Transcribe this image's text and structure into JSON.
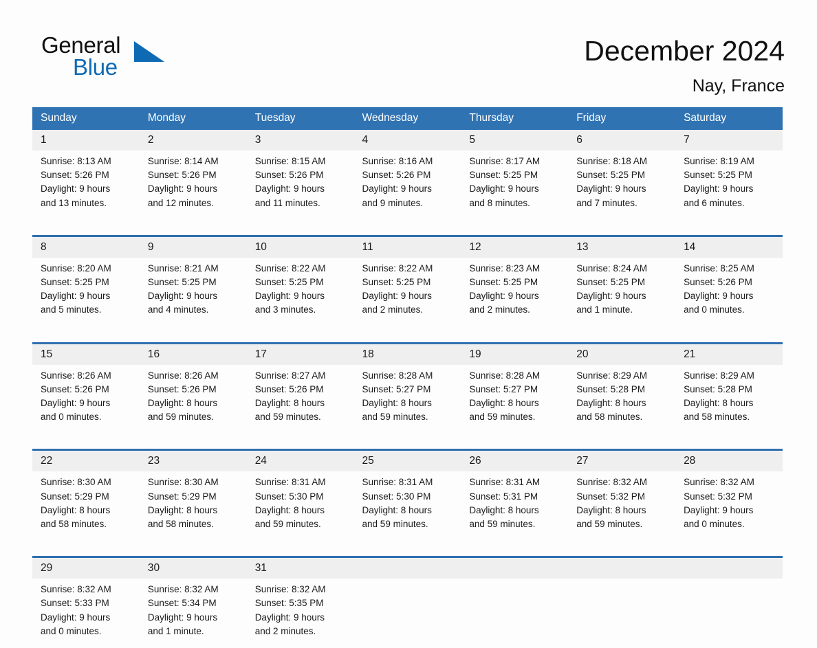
{
  "brand": {
    "name_part1": "General",
    "name_part2": "Blue",
    "logo_icon": "triangle-flag-icon",
    "accent_color": "#0f6ab4"
  },
  "header": {
    "title": "December 2024",
    "subtitle": "Nay, France"
  },
  "theme": {
    "header_blue": "#3073b3",
    "row_border_blue": "#2f6fb0",
    "daynum_band": "#efefef",
    "page_background": "#fdfdfd",
    "text": "#1a1a1a"
  },
  "calendar": {
    "weekday_headers": [
      "Sunday",
      "Monday",
      "Tuesday",
      "Wednesday",
      "Thursday",
      "Friday",
      "Saturday"
    ],
    "labels": {
      "sunrise_prefix": "Sunrise:",
      "sunset_prefix": "Sunset:",
      "daylight_prefix": "Daylight:"
    },
    "weeks": [
      [
        {
          "day": "1",
          "sunrise": "Sunrise: 8:13 AM",
          "sunset": "Sunset: 5:26 PM",
          "daylight_line1": "Daylight: 9 hours",
          "daylight_line2": "and 13 minutes."
        },
        {
          "day": "2",
          "sunrise": "Sunrise: 8:14 AM",
          "sunset": "Sunset: 5:26 PM",
          "daylight_line1": "Daylight: 9 hours",
          "daylight_line2": "and 12 minutes."
        },
        {
          "day": "3",
          "sunrise": "Sunrise: 8:15 AM",
          "sunset": "Sunset: 5:26 PM",
          "daylight_line1": "Daylight: 9 hours",
          "daylight_line2": "and 11 minutes."
        },
        {
          "day": "4",
          "sunrise": "Sunrise: 8:16 AM",
          "sunset": "Sunset: 5:26 PM",
          "daylight_line1": "Daylight: 9 hours",
          "daylight_line2": "and 9 minutes."
        },
        {
          "day": "5",
          "sunrise": "Sunrise: 8:17 AM",
          "sunset": "Sunset: 5:25 PM",
          "daylight_line1": "Daylight: 9 hours",
          "daylight_line2": "and 8 minutes."
        },
        {
          "day": "6",
          "sunrise": "Sunrise: 8:18 AM",
          "sunset": "Sunset: 5:25 PM",
          "daylight_line1": "Daylight: 9 hours",
          "daylight_line2": "and 7 minutes."
        },
        {
          "day": "7",
          "sunrise": "Sunrise: 8:19 AM",
          "sunset": "Sunset: 5:25 PM",
          "daylight_line1": "Daylight: 9 hours",
          "daylight_line2": "and 6 minutes."
        }
      ],
      [
        {
          "day": "8",
          "sunrise": "Sunrise: 8:20 AM",
          "sunset": "Sunset: 5:25 PM",
          "daylight_line1": "Daylight: 9 hours",
          "daylight_line2": "and 5 minutes."
        },
        {
          "day": "9",
          "sunrise": "Sunrise: 8:21 AM",
          "sunset": "Sunset: 5:25 PM",
          "daylight_line1": "Daylight: 9 hours",
          "daylight_line2": "and 4 minutes."
        },
        {
          "day": "10",
          "sunrise": "Sunrise: 8:22 AM",
          "sunset": "Sunset: 5:25 PM",
          "daylight_line1": "Daylight: 9 hours",
          "daylight_line2": "and 3 minutes."
        },
        {
          "day": "11",
          "sunrise": "Sunrise: 8:22 AM",
          "sunset": "Sunset: 5:25 PM",
          "daylight_line1": "Daylight: 9 hours",
          "daylight_line2": "and 2 minutes."
        },
        {
          "day": "12",
          "sunrise": "Sunrise: 8:23 AM",
          "sunset": "Sunset: 5:25 PM",
          "daylight_line1": "Daylight: 9 hours",
          "daylight_line2": "and 2 minutes."
        },
        {
          "day": "13",
          "sunrise": "Sunrise: 8:24 AM",
          "sunset": "Sunset: 5:25 PM",
          "daylight_line1": "Daylight: 9 hours",
          "daylight_line2": "and 1 minute."
        },
        {
          "day": "14",
          "sunrise": "Sunrise: 8:25 AM",
          "sunset": "Sunset: 5:26 PM",
          "daylight_line1": "Daylight: 9 hours",
          "daylight_line2": "and 0 minutes."
        }
      ],
      [
        {
          "day": "15",
          "sunrise": "Sunrise: 8:26 AM",
          "sunset": "Sunset: 5:26 PM",
          "daylight_line1": "Daylight: 9 hours",
          "daylight_line2": "and 0 minutes."
        },
        {
          "day": "16",
          "sunrise": "Sunrise: 8:26 AM",
          "sunset": "Sunset: 5:26 PM",
          "daylight_line1": "Daylight: 8 hours",
          "daylight_line2": "and 59 minutes."
        },
        {
          "day": "17",
          "sunrise": "Sunrise: 8:27 AM",
          "sunset": "Sunset: 5:26 PM",
          "daylight_line1": "Daylight: 8 hours",
          "daylight_line2": "and 59 minutes."
        },
        {
          "day": "18",
          "sunrise": "Sunrise: 8:28 AM",
          "sunset": "Sunset: 5:27 PM",
          "daylight_line1": "Daylight: 8 hours",
          "daylight_line2": "and 59 minutes."
        },
        {
          "day": "19",
          "sunrise": "Sunrise: 8:28 AM",
          "sunset": "Sunset: 5:27 PM",
          "daylight_line1": "Daylight: 8 hours",
          "daylight_line2": "and 59 minutes."
        },
        {
          "day": "20",
          "sunrise": "Sunrise: 8:29 AM",
          "sunset": "Sunset: 5:28 PM",
          "daylight_line1": "Daylight: 8 hours",
          "daylight_line2": "and 58 minutes."
        },
        {
          "day": "21",
          "sunrise": "Sunrise: 8:29 AM",
          "sunset": "Sunset: 5:28 PM",
          "daylight_line1": "Daylight: 8 hours",
          "daylight_line2": "and 58 minutes."
        }
      ],
      [
        {
          "day": "22",
          "sunrise": "Sunrise: 8:30 AM",
          "sunset": "Sunset: 5:29 PM",
          "daylight_line1": "Daylight: 8 hours",
          "daylight_line2": "and 58 minutes."
        },
        {
          "day": "23",
          "sunrise": "Sunrise: 8:30 AM",
          "sunset": "Sunset: 5:29 PM",
          "daylight_line1": "Daylight: 8 hours",
          "daylight_line2": "and 58 minutes."
        },
        {
          "day": "24",
          "sunrise": "Sunrise: 8:31 AM",
          "sunset": "Sunset: 5:30 PM",
          "daylight_line1": "Daylight: 8 hours",
          "daylight_line2": "and 59 minutes."
        },
        {
          "day": "25",
          "sunrise": "Sunrise: 8:31 AM",
          "sunset": "Sunset: 5:30 PM",
          "daylight_line1": "Daylight: 8 hours",
          "daylight_line2": "and 59 minutes."
        },
        {
          "day": "26",
          "sunrise": "Sunrise: 8:31 AM",
          "sunset": "Sunset: 5:31 PM",
          "daylight_line1": "Daylight: 8 hours",
          "daylight_line2": "and 59 minutes."
        },
        {
          "day": "27",
          "sunrise": "Sunrise: 8:32 AM",
          "sunset": "Sunset: 5:32 PM",
          "daylight_line1": "Daylight: 8 hours",
          "daylight_line2": "and 59 minutes."
        },
        {
          "day": "28",
          "sunrise": "Sunrise: 8:32 AM",
          "sunset": "Sunset: 5:32 PM",
          "daylight_line1": "Daylight: 9 hours",
          "daylight_line2": "and 0 minutes."
        }
      ],
      [
        {
          "day": "29",
          "sunrise": "Sunrise: 8:32 AM",
          "sunset": "Sunset: 5:33 PM",
          "daylight_line1": "Daylight: 9 hours",
          "daylight_line2": "and 0 minutes."
        },
        {
          "day": "30",
          "sunrise": "Sunrise: 8:32 AM",
          "sunset": "Sunset: 5:34 PM",
          "daylight_line1": "Daylight: 9 hours",
          "daylight_line2": "and 1 minute."
        },
        {
          "day": "31",
          "sunrise": "Sunrise: 8:32 AM",
          "sunset": "Sunset: 5:35 PM",
          "daylight_line1": "Daylight: 9 hours",
          "daylight_line2": "and 2 minutes."
        },
        {
          "day": "",
          "sunrise": "",
          "sunset": "",
          "daylight_line1": "",
          "daylight_line2": ""
        },
        {
          "day": "",
          "sunrise": "",
          "sunset": "",
          "daylight_line1": "",
          "daylight_line2": ""
        },
        {
          "day": "",
          "sunrise": "",
          "sunset": "",
          "daylight_line1": "",
          "daylight_line2": ""
        },
        {
          "day": "",
          "sunrise": "",
          "sunset": "",
          "daylight_line1": "",
          "daylight_line2": ""
        }
      ]
    ]
  }
}
